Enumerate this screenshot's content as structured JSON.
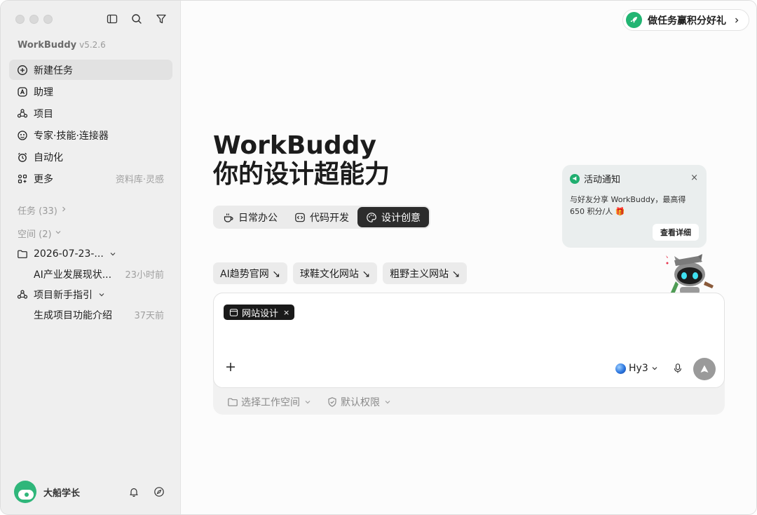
{
  "app": {
    "name": "WorkBuddy",
    "version": "v5.2.6"
  },
  "sidebar": {
    "nav": [
      {
        "label": "新建任务",
        "icon": "plus-circle-icon",
        "active": true,
        "hint": ""
      },
      {
        "label": "助理",
        "icon": "assistant-icon",
        "active": false,
        "hint": ""
      },
      {
        "label": "项目",
        "icon": "project-icon",
        "active": false,
        "hint": ""
      },
      {
        "label": "专家·技能·连接器",
        "icon": "expert-icon",
        "active": false,
        "hint": ""
      },
      {
        "label": "自动化",
        "icon": "alarm-icon",
        "active": false,
        "hint": ""
      },
      {
        "label": "更多",
        "icon": "grid-icon",
        "active": false,
        "hint": "资料库·灵感"
      }
    ],
    "tasks_header": "任务 (33)",
    "spaces_header": "空间 (2)",
    "spaces": [
      {
        "label": "2026-07-23-...",
        "type": "folder",
        "time": ""
      },
      {
        "label": "AI产业发展现状...",
        "type": "child",
        "time": "23小时前"
      },
      {
        "label": "项目新手指引",
        "type": "project",
        "time": ""
      },
      {
        "label": "生成项目功能介绍",
        "type": "child",
        "time": "37天前"
      }
    ],
    "user": {
      "name": "大船学长"
    }
  },
  "main": {
    "promo": "做任务赢积分好礼",
    "hero_line1": "WorkBuddy",
    "hero_line2": "你的设计超能力",
    "modes": [
      {
        "label": "日常办公",
        "icon": "cup-icon",
        "active": false
      },
      {
        "label": "代码开发",
        "icon": "code-icon",
        "active": false
      },
      {
        "label": "设计创意",
        "icon": "palette-icon",
        "active": true
      }
    ],
    "suggestions": [
      "AI趋势官网 ↘",
      "球鞋文化网站 ↘",
      "粗野主义网站 ↘"
    ],
    "notice": {
      "title": "活动通知",
      "close": "×",
      "body_line1": "与好友分享 WorkBuddy，最高得",
      "body_line2": "650 积分/人 🎁",
      "button": "查看详细"
    },
    "composer": {
      "tag": "网站设计",
      "tag_close": "×",
      "model": "Hy3",
      "workspace": "选择工作空间",
      "permission": "默认权限"
    }
  },
  "colors": {
    "accent_green": "#22b573",
    "active_dark": "#2c2c2c"
  }
}
